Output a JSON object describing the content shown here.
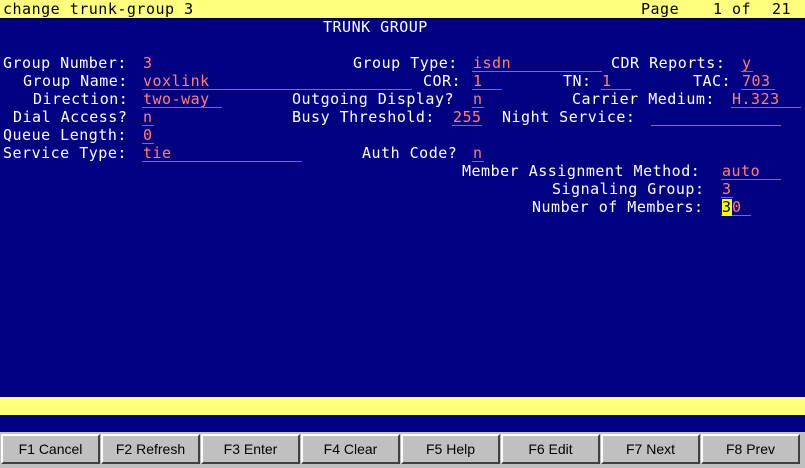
{
  "command": "change trunk-group 3",
  "page_label": "Page",
  "page_current": "1",
  "page_of": "of",
  "page_total": "21",
  "form_title": "TRUNK GROUP",
  "labels": {
    "group_number": "Group Number:",
    "group_type": "Group Type:",
    "cdr_reports": "CDR Reports:",
    "group_name": "Group Name:",
    "cor": "COR:",
    "tn": "TN:",
    "tac": "TAC:",
    "direction": "Direction:",
    "outgoing_display": "Outgoing Display?",
    "carrier_medium": "Carrier Medium:",
    "dial_access": "Dial Access?",
    "busy_threshold": "Busy Threshold:",
    "night_service": "Night Service:",
    "queue_length": "Queue Length:",
    "service_type": "Service Type:",
    "auth_code": "Auth Code?",
    "member_assignment_method": "Member Assignment Method:",
    "signaling_group": "Signaling Group:",
    "number_of_members": "Number of Members:"
  },
  "values": {
    "group_number": "3",
    "group_type": "isdn",
    "cdr_reports": "y",
    "group_name": "voxlink",
    "cor": "1",
    "tn": "1",
    "tac": "703",
    "direction": "two-way",
    "outgoing_display": "n",
    "carrier_medium": "H.323",
    "dial_access": "n",
    "busy_threshold": "255",
    "night_service": "",
    "queue_length": "0",
    "service_type": "tie",
    "auth_code": "n",
    "member_assignment_method": "auto",
    "signaling_group": "3",
    "number_of_members_cursor": "3",
    "number_of_members_rest": "0"
  },
  "function_keys": [
    "F1 Cancel",
    "F2 Refresh",
    "F3 Enter",
    "F4 Clear",
    "F5 Help",
    "F6 Edit",
    "F7 Next",
    "F8 Prev"
  ],
  "colors": {
    "screen_bg": "#000080",
    "bar_bg": "#ffff80",
    "field_value": "#ff8080",
    "label_text": "#ffffff"
  }
}
